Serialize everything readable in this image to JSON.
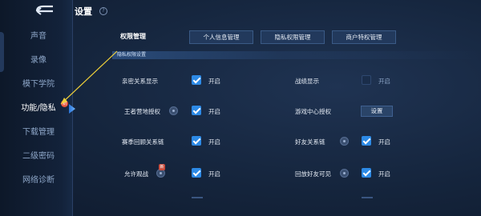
{
  "header": {
    "title": "设置",
    "help_glyph": "?"
  },
  "sidebar": {
    "items": [
      {
        "label": "声音"
      },
      {
        "label": "录像"
      },
      {
        "label": "模下学院"
      },
      {
        "label": "功能/隐私"
      },
      {
        "label": "下载管理"
      },
      {
        "label": "二级密码"
      },
      {
        "label": "网络诊断"
      }
    ],
    "active_index": 3,
    "badge_glyph": "新"
  },
  "permissions": {
    "label": "权限管理",
    "buttons": [
      "个人信息管理",
      "隐私权限管理",
      "商户特权管理"
    ]
  },
  "privacy": {
    "section_title": "隐私权限设置",
    "rows": [
      {
        "label": "亲密关系显示",
        "checked": true,
        "state": "开启"
      },
      {
        "label": "战绩显示",
        "checked": false,
        "state": "开启"
      },
      {
        "label": "王者营地授权",
        "checked": true,
        "state": "开启"
      },
      {
        "label": "游戏中心授权",
        "button": "设置"
      },
      {
        "label": "赛季回顾关系链",
        "checked": true,
        "state": "开启"
      },
      {
        "label": "好友关系链",
        "checked": true,
        "state": "开启"
      },
      {
        "label": "允许观战",
        "checked": true,
        "state": "开启"
      },
      {
        "label": "回放好友可见",
        "checked": true,
        "state": "开启"
      }
    ]
  },
  "colors": {
    "accent": "#2d8ae6",
    "annotation_arrow": "#f2d23a",
    "badge": "#e8523b"
  },
  "icons": [
    "back-arrow-icon",
    "help-icon",
    "info-icon",
    "checkmark-icon",
    "new-badge-icon"
  ]
}
